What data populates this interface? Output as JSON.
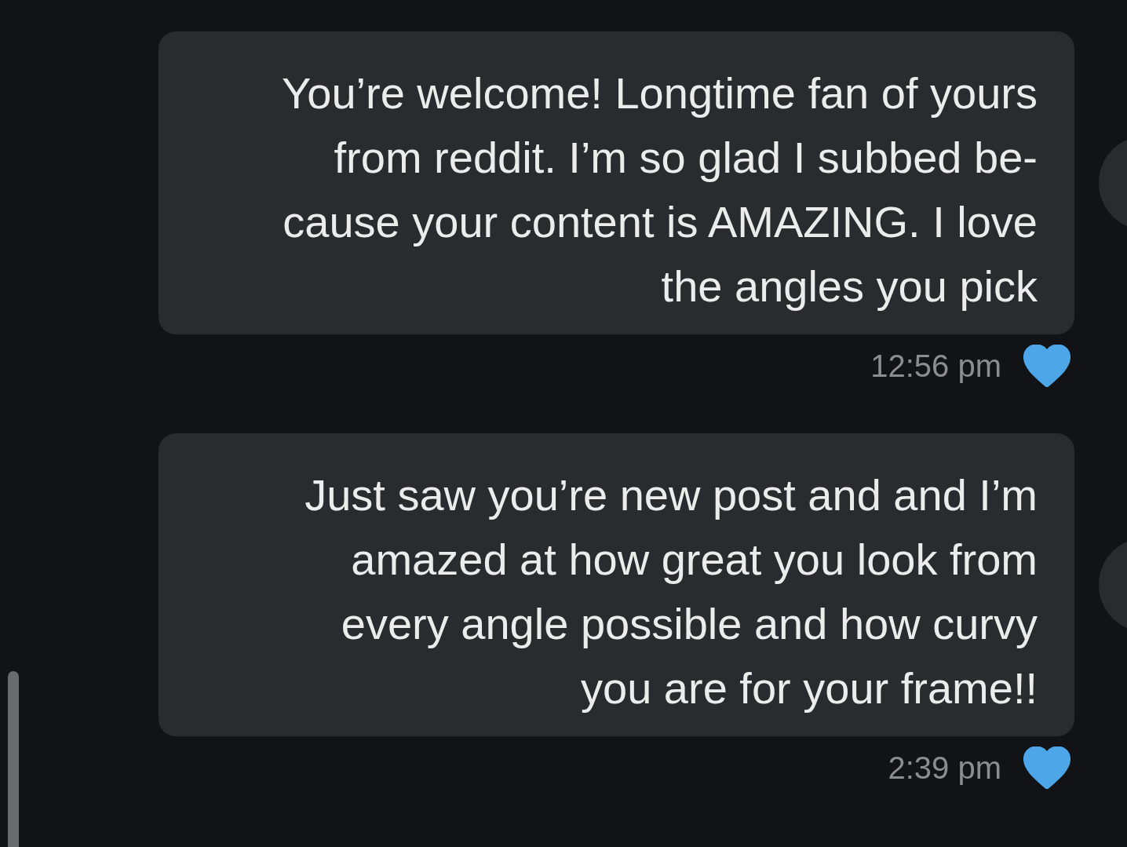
{
  "messages": [
    {
      "lines": [
        "You’re welcome! Longtime fan of yours",
        "from reddit. I’m so glad I subbed be-",
        "cause your content is AMAZING. I love",
        "the angles you pick"
      ],
      "time": "12:56 pm",
      "liked": true
    },
    {
      "lines": [
        "Just saw you’re new post and and I’m",
        "amazed at how great you look from",
        "every angle possible and how curvy",
        "you are for your frame!!"
      ],
      "time": "2:39 pm",
      "liked": true
    }
  ]
}
